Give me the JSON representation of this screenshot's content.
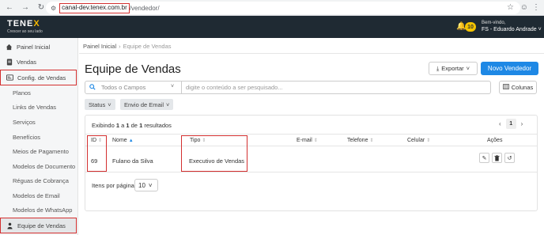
{
  "browser": {
    "url_host": "canal-dev.tenex.com.br",
    "url_path": "/vendedor/"
  },
  "header": {
    "logo_text": "TENE",
    "logo_accent": "X",
    "tagline": "Crescer ao seu lado",
    "notification_count": "10",
    "welcome": "Bem-vindo,",
    "user_name": "FS - Eduardo Andrade"
  },
  "sidebar": {
    "items": [
      {
        "label": "Painel Inicial",
        "icon": "home-icon"
      },
      {
        "label": "Vendas",
        "icon": "receipt-icon"
      },
      {
        "label": "Config. de Vendas",
        "icon": "settings-card-icon"
      },
      {
        "label": "Planos"
      },
      {
        "label": "Links de Vendas"
      },
      {
        "label": "Serviços"
      },
      {
        "label": "Benefícios"
      },
      {
        "label": "Meios de Pagamento"
      },
      {
        "label": "Modelos de Documento"
      },
      {
        "label": "Réguas de Cobrança"
      },
      {
        "label": "Modelos de Email"
      },
      {
        "label": "Modelos de WhatsApp"
      },
      {
        "label": "Equipe de Vendas",
        "icon": "person-icon"
      }
    ]
  },
  "breadcrumb": {
    "root": "Painel Inicial",
    "current": "Equipe de Vendas"
  },
  "page": {
    "title": "Equipe de Vendas",
    "export_label": "Exportar",
    "new_label": "Novo Vendedor",
    "columns_label": "Colunas"
  },
  "search": {
    "fields_label": "Todos o Campos",
    "placeholder": "digite o conteúdo a ser pesquisado..."
  },
  "filters": {
    "status": "Status",
    "email_send": "Envio de Email"
  },
  "table": {
    "results_prefix": "Exibindo ",
    "results_from": "1",
    "results_mid": " a ",
    "results_to": "1",
    "results_de": " de ",
    "results_total": "1",
    "results_suffix": " resultados",
    "current_page": "1",
    "headers": {
      "id": "ID",
      "name": "Nome",
      "type": "Tipo",
      "email": "E-mail",
      "phone": "Telefone",
      "mobile": "Celular",
      "actions": "Ações"
    },
    "rows": [
      {
        "id": "69",
        "name": "Fulano da Silva",
        "type": "Executivo de Vendas",
        "email": "",
        "phone": "",
        "mobile": ""
      }
    ],
    "items_per_page_label": "Itens por página",
    "items_per_page": "10"
  },
  "colors": {
    "header_bg": "#1f2a33",
    "accent": "#1e88e5",
    "badge": "#f5c400",
    "highlight": "#d32f2f"
  }
}
